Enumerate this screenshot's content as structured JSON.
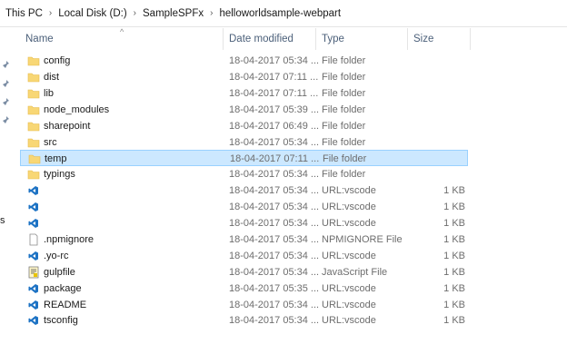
{
  "breadcrumb": [
    "This PC",
    "Local Disk (D:)",
    "SampleSPFx",
    "helloworldsample-webpart"
  ],
  "columns": {
    "name": "Name",
    "date": "Date modified",
    "type": "Type",
    "size": "Size"
  },
  "side_text": "s",
  "files": [
    {
      "name": "config",
      "date": "18-04-2017 05:34 ...",
      "type": "File folder",
      "size": "",
      "icon": "folder-icon"
    },
    {
      "name": "dist",
      "date": "18-04-2017 07:11 ...",
      "type": "File folder",
      "size": "",
      "icon": "folder-icon"
    },
    {
      "name": "lib",
      "date": "18-04-2017 07:11 ...",
      "type": "File folder",
      "size": "",
      "icon": "folder-icon"
    },
    {
      "name": "node_modules",
      "date": "18-04-2017 05:39 ...",
      "type": "File folder",
      "size": "",
      "icon": "folder-icon"
    },
    {
      "name": "sharepoint",
      "date": "18-04-2017 06:49 ...",
      "type": "File folder",
      "size": "",
      "icon": "folder-icon"
    },
    {
      "name": "src",
      "date": "18-04-2017 05:34 ...",
      "type": "File folder",
      "size": "",
      "icon": "folder-icon"
    },
    {
      "name": "temp",
      "date": "18-04-2017 07:11 ...",
      "type": "File folder",
      "size": "",
      "icon": "folder-icon",
      "selected": true
    },
    {
      "name": "typings",
      "date": "18-04-2017 05:34 ...",
      "type": "File folder",
      "size": "",
      "icon": "folder-icon"
    },
    {
      "name": "",
      "date": "18-04-2017 05:34 ...",
      "type": "URL:vscode",
      "size": "1 KB",
      "icon": "vscode-file-icon"
    },
    {
      "name": "",
      "date": "18-04-2017 05:34 ...",
      "type": "URL:vscode",
      "size": "1 KB",
      "icon": "vscode-file-icon"
    },
    {
      "name": "",
      "date": "18-04-2017 05:34 ...",
      "type": "URL:vscode",
      "size": "1 KB",
      "icon": "vscode-file-icon"
    },
    {
      "name": ".npmignore",
      "date": "18-04-2017 05:34 ...",
      "type": "NPMIGNORE File",
      "size": "1 KB",
      "icon": "blank-file-icon"
    },
    {
      "name": ".yo-rc",
      "date": "18-04-2017 05:34 ...",
      "type": "URL:vscode",
      "size": "1 KB",
      "icon": "vscode-file-icon"
    },
    {
      "name": "gulpfile",
      "date": "18-04-2017 05:34 ...",
      "type": "JavaScript File",
      "size": "1 KB",
      "icon": "js-file-icon"
    },
    {
      "name": "package",
      "date": "18-04-2017 05:35 ...",
      "type": "URL:vscode",
      "size": "1 KB",
      "icon": "vscode-file-icon"
    },
    {
      "name": "README",
      "date": "18-04-2017 05:34 ...",
      "type": "URL:vscode",
      "size": "1 KB",
      "icon": "vscode-file-icon"
    },
    {
      "name": "tsconfig",
      "date": "18-04-2017 05:34 ...",
      "type": "URL:vscode",
      "size": "1 KB",
      "icon": "vscode-file-icon"
    }
  ],
  "colors": {
    "folder": "#f8d775",
    "folder_dark": "#e6b94a",
    "vscode": "#1e73c4",
    "selection_bg": "#cce8ff",
    "selection_border": "#99d1ff",
    "header_text": "#4c607a"
  }
}
